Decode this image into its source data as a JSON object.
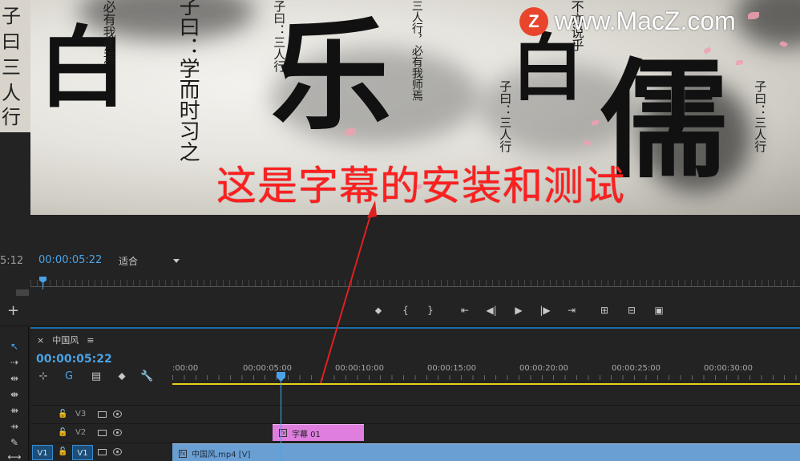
{
  "watermark": {
    "logo_letter": "Z",
    "text": "www.MacZ.com"
  },
  "preview": {
    "subtitle": "这是字幕的安装和测试",
    "bg_glyphs": {
      "col1": "子曰：学而时习之",
      "col2": "必有我师焉",
      "col3": "子曰：三人行",
      "col4": "三人行，必有我师焉",
      "col5": "子曰：三人行",
      "col6": "子曰：三人行",
      "col7": "不亦说乎",
      "big1": "乐",
      "big2": "儒",
      "big3": "白",
      "big4": "白",
      "strip": [
        "子",
        "曰",
        "三",
        "人",
        "行"
      ]
    }
  },
  "monitor": {
    "left_timecode": "5:12",
    "program_timecode": "00:00:05:22",
    "fit_label": "适合"
  },
  "transport": {
    "add_label": "+",
    "buttons": {
      "marker": "⬥",
      "in": "{",
      "out": "}",
      "go_in": "⇤",
      "step_back": "◀|",
      "play": "▶",
      "step_fwd": "|▶",
      "go_out": "⇥",
      "insert": "⊞",
      "overwrite": "⊟",
      "export_frame": "▣"
    }
  },
  "tools": {
    "selection": "↖",
    "track_select": "⇢",
    "ripple": "⇹",
    "rolling": "⇼",
    "rate": "⇻",
    "slip": "⇸",
    "razor": "✎",
    "last": "⟷"
  },
  "timeline": {
    "close": "×",
    "sequence_name": "中国风",
    "menu_icon": "≡",
    "timecode": "00:00:05:22",
    "header_tools": {
      "snap": "⊹",
      "linked": "G",
      "add_marker_seq": "▤",
      "marker": "⬥",
      "settings": "🔧"
    },
    "ruler_labels": [
      ":00:00",
      "00:00:05:00",
      "00:00:10:00",
      "00:00:15:00",
      "00:00:20:00",
      "00:00:25:00",
      "00:00:30:00"
    ],
    "tracks": [
      {
        "name": "V3"
      },
      {
        "name": "V2"
      },
      {
        "name": "V1",
        "source": "V1"
      }
    ],
    "lock_glyph": "🔓",
    "clips": {
      "title_clip": "字幕 01",
      "video_clip": "中国风.mp4 [V]",
      "fx": "fx"
    }
  },
  "colors": {
    "subtitle": "#ff1f1f",
    "accent": "#4aa3e6",
    "title_clip": "#e07ee0",
    "video_clip": "#6a9fd4",
    "work_area": "#e8d21a"
  }
}
